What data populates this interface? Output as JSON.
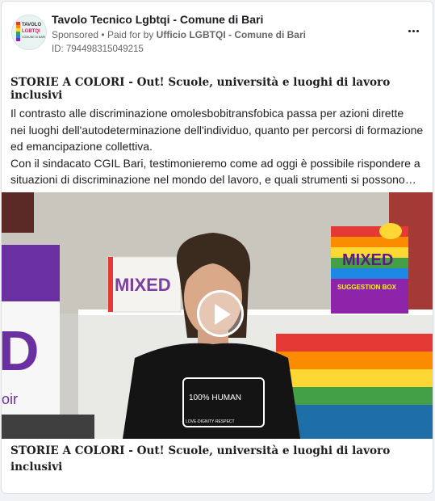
{
  "post": {
    "page_name": "Tavolo Tecnico Lgbtqi - Comune di Bari",
    "sponsored": "Sponsored",
    "separator": "•",
    "paid_for_prefix": "Paid for by",
    "paid_for_by": "Ufficio LGBTQI - Comune di Bari",
    "ad_id": "ID: 794498315049215",
    "headline": "STORIE A COLORI - Out! Scuole, università e luoghi di lavoro inclusivi",
    "body_lines": [
      "Il contrasto alle discriminazione omolesbobitransfobica passa per azioni dirette",
      "nei luoghi dell'autodeterminazione dell'individuo, quanto per percorsi di formazione",
      "ed emancipazione collettiva.",
      "Con il sindacato CGIL Bari, testimonieremo come ad oggi è possibile rispondere a",
      "situazioni di discriminazione nel mondo del lavoro, e quali strumenti si possono…"
    ],
    "footer_title_lines": [
      "STORIE A COLORI - Out! Scuole, università e luoghi di lavoro",
      "inclusivi"
    ]
  },
  "avatar_text": {
    "line1": "TAVOLO",
    "line2": "LGBTQI",
    "line3": "COMUNE DI BARI"
  },
  "video": {
    "poster_sign": "MIXED",
    "box_sign": "MIXED",
    "box_sub": "SUGGESTION BOX",
    "bag_letter": "D",
    "bag_text": "oir",
    "shirt_line1": "100% HUMAN",
    "shirt_line2": "LOVE·DIGNITY·RESPECT"
  },
  "icons": {
    "more": "more-options-icon",
    "play": "play-icon"
  },
  "colors": {
    "text_primary": "#1c1e21",
    "text_secondary": "#65676b",
    "card_border": "#dcdfe3"
  }
}
